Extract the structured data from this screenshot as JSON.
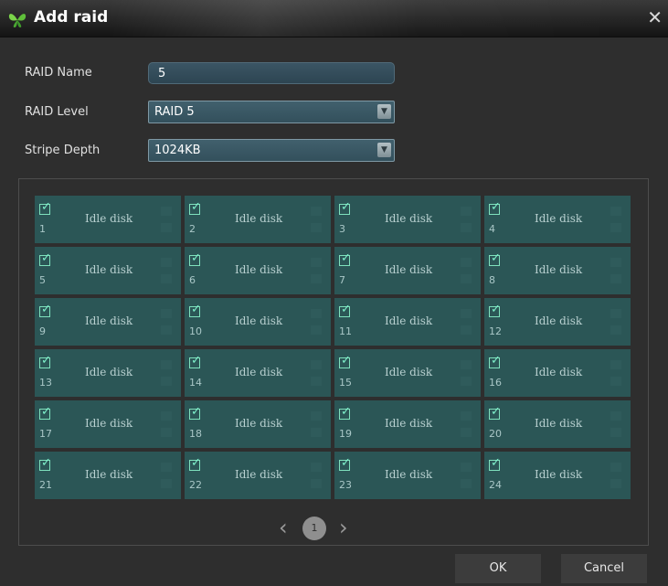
{
  "dialog": {
    "title": "Add raid"
  },
  "form": {
    "raid_name_label": "RAID Name",
    "raid_name_value": "5",
    "raid_level_label": "RAID Level",
    "raid_level_value": "RAID 5",
    "stripe_depth_label": "Stripe Depth",
    "stripe_depth_value": "1024KB"
  },
  "disks": [
    {
      "number": "1",
      "status": "Idle disk",
      "checked": true
    },
    {
      "number": "2",
      "status": "Idle disk",
      "checked": true
    },
    {
      "number": "3",
      "status": "Idle disk",
      "checked": true
    },
    {
      "number": "4",
      "status": "Idle disk",
      "checked": true
    },
    {
      "number": "5",
      "status": "Idle disk",
      "checked": true
    },
    {
      "number": "6",
      "status": "Idle disk",
      "checked": true
    },
    {
      "number": "7",
      "status": "Idle disk",
      "checked": true
    },
    {
      "number": "8",
      "status": "Idle disk",
      "checked": true
    },
    {
      "number": "9",
      "status": "Idle disk",
      "checked": true
    },
    {
      "number": "10",
      "status": "Idle disk",
      "checked": true
    },
    {
      "number": "11",
      "status": "Idle disk",
      "checked": true
    },
    {
      "number": "12",
      "status": "Idle disk",
      "checked": true
    },
    {
      "number": "13",
      "status": "Idle disk",
      "checked": true
    },
    {
      "number": "14",
      "status": "Idle disk",
      "checked": true
    },
    {
      "number": "15",
      "status": "Idle disk",
      "checked": true
    },
    {
      "number": "16",
      "status": "Idle disk",
      "checked": true
    },
    {
      "number": "17",
      "status": "Idle disk",
      "checked": true
    },
    {
      "number": "18",
      "status": "Idle disk",
      "checked": true
    },
    {
      "number": "19",
      "status": "Idle disk",
      "checked": true
    },
    {
      "number": "20",
      "status": "Idle disk",
      "checked": true
    },
    {
      "number": "21",
      "status": "Idle disk",
      "checked": true
    },
    {
      "number": "22",
      "status": "Idle disk",
      "checked": true
    },
    {
      "number": "23",
      "status": "Idle disk",
      "checked": true
    },
    {
      "number": "24",
      "status": "Idle disk",
      "checked": true
    }
  ],
  "pagination": {
    "prev": "‹",
    "current": "1",
    "next": "›"
  },
  "buttons": {
    "ok": "OK",
    "cancel": "Cancel"
  },
  "icons": {
    "logo": "butterfly-logo-icon",
    "close": "close-icon",
    "dropdown": "chevron-down-icon",
    "checkbox": "checkbox-checked-icon"
  },
  "colors": {
    "cell_bg": "#2b5656",
    "check": "#7ef0ca",
    "dialog_bg": "#2e2e2e"
  }
}
